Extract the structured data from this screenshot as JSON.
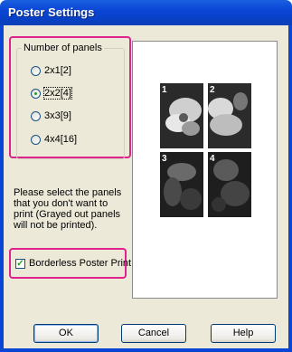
{
  "window": {
    "title": "Poster Settings"
  },
  "panels_group": {
    "label": "Number of panels",
    "options": [
      {
        "label": "2x1[2]",
        "checked": false
      },
      {
        "label": "2x2[4]",
        "checked": true
      },
      {
        "label": "3x3[9]",
        "checked": false
      },
      {
        "label": "4x4[16]",
        "checked": false
      }
    ]
  },
  "hint": "Please select the panels that you don't want to print (Grayed out panels will not be printed).",
  "borderless": {
    "label": "Borderless Poster Print",
    "checked": true
  },
  "preview": {
    "panel_numbers": [
      "1",
      "2",
      "3",
      "4"
    ]
  },
  "buttons": {
    "ok": "OK",
    "cancel": "Cancel",
    "help": "Help"
  },
  "colors": {
    "highlight": "#e0238c",
    "title_bar": "#0a46d6",
    "dialog_bg": "#ece9d8"
  }
}
